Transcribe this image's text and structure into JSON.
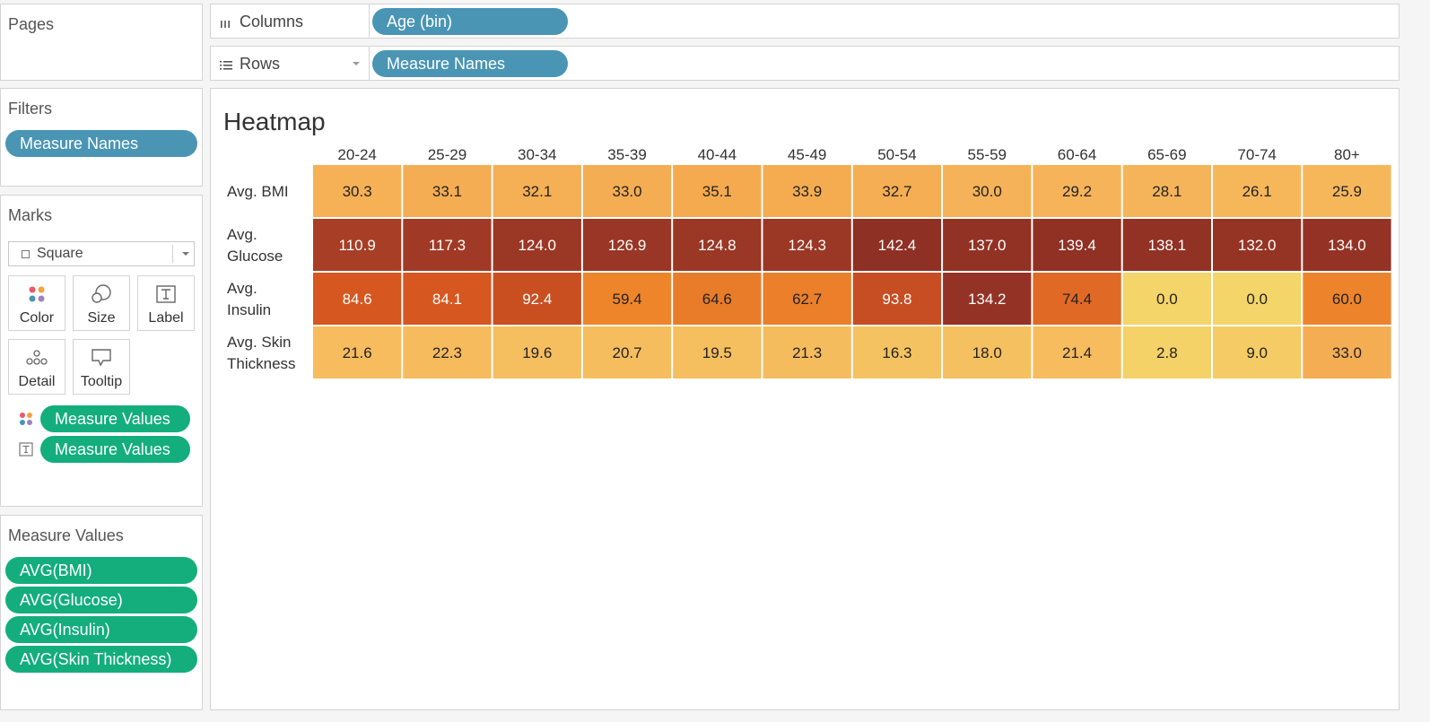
{
  "pages": {
    "title": "Pages"
  },
  "filters": {
    "title": "Filters",
    "pills": [
      "Measure Names"
    ]
  },
  "marks": {
    "title": "Marks",
    "mark_type": "Square",
    "cards": [
      {
        "label": "Color",
        "icon": "color-icon"
      },
      {
        "label": "Size",
        "icon": "size-icon"
      },
      {
        "label": "Label",
        "icon": "label-icon"
      },
      {
        "label": "Detail",
        "icon": "detail-icon"
      },
      {
        "label": "Tooltip",
        "icon": "tooltip-icon"
      }
    ],
    "encodings": [
      {
        "icon": "color-dots-icon",
        "label": "Measure Values"
      },
      {
        "icon": "text-label-icon",
        "label": "Measure Values"
      }
    ]
  },
  "measure_values": {
    "title": "Measure Values",
    "pills": [
      "AVG(BMI)",
      "AVG(Glucose)",
      "AVG(Insulin)",
      "AVG(Skin Thickness)"
    ]
  },
  "columns_shelf": {
    "icon": "columns-icon",
    "label": "Columns",
    "pill": "Age (bin)"
  },
  "rows_shelf": {
    "icon": "rows-icon",
    "label": "Rows",
    "pill": "Measure Names"
  },
  "chart_data": {
    "type": "heatmap",
    "title": "Heatmap",
    "columns": [
      "20-24",
      "25-29",
      "30-34",
      "35-39",
      "40-44",
      "45-49",
      "50-54",
      "55-59",
      "60-64",
      "65-69",
      "70-74",
      "80+"
    ],
    "rows": [
      {
        "name": "Avg. BMI",
        "values": [
          30.3,
          33.1,
          32.1,
          33.0,
          35.1,
          33.9,
          32.7,
          30.0,
          29.2,
          28.1,
          26.1,
          25.9
        ]
      },
      {
        "name": "Avg. Glucose",
        "values": [
          110.9,
          117.3,
          124.0,
          126.9,
          124.8,
          124.3,
          142.4,
          137.0,
          139.4,
          138.1,
          132.0,
          134.0
        ]
      },
      {
        "name": "Avg. Insulin",
        "values": [
          84.6,
          84.1,
          92.4,
          59.4,
          64.6,
          62.7,
          93.8,
          134.2,
          74.4,
          0.0,
          0.0,
          60.0
        ]
      },
      {
        "name": "Avg. Skin Thickness",
        "values": [
          21.6,
          22.3,
          19.6,
          20.7,
          19.5,
          21.3,
          16.3,
          18.0,
          21.4,
          2.8,
          9.0,
          33.0
        ]
      }
    ],
    "color_scale": [
      "#f4d56a",
      "#f6b45a",
      "#f08a2c",
      "#d65520",
      "#a23b26",
      "#8e3024"
    ],
    "value_range": [
      0,
      142.4
    ]
  }
}
